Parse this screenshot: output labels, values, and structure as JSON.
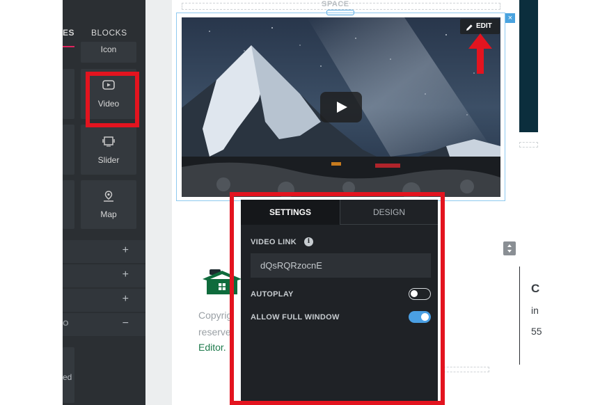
{
  "sidebar": {
    "tab_partial": "ES",
    "tab_blocks": "BLOCKS",
    "tiles": {
      "icon_label": "Icon",
      "video_label": "Video",
      "slider_label": "Slider",
      "map_label": "Map",
      "partial_label": "ed"
    },
    "accordion": [
      "+",
      "+",
      "+",
      "−"
    ],
    "accordion_partial_text": "O"
  },
  "canvas": {
    "space_label": "SPACE",
    "edit_label": "EDIT",
    "close_label": "×",
    "copyright_line1": "Copyrig",
    "copyright_line2": "reserve",
    "editor_link": "Editor.",
    "right_text": [
      "C",
      "in",
      "55"
    ]
  },
  "settings_panel": {
    "tab_settings": "SETTINGS",
    "tab_design": "DESIGN",
    "video_link_label": "VIDEO LINK",
    "video_link_value": "dQsRQRzocnE",
    "autoplay_label": "AUTOPLAY",
    "autoplay_on": false,
    "allow_full_window_label": "ALLOW FULL WINDOW",
    "allow_full_window_on": true
  },
  "colors": {
    "highlight_red": "#e3141f",
    "sidebar_bg": "#2b2f33",
    "toggle_on": "#4a9fe3",
    "link_green": "#1e7a4c",
    "selection_blue": "#4aa3df"
  }
}
